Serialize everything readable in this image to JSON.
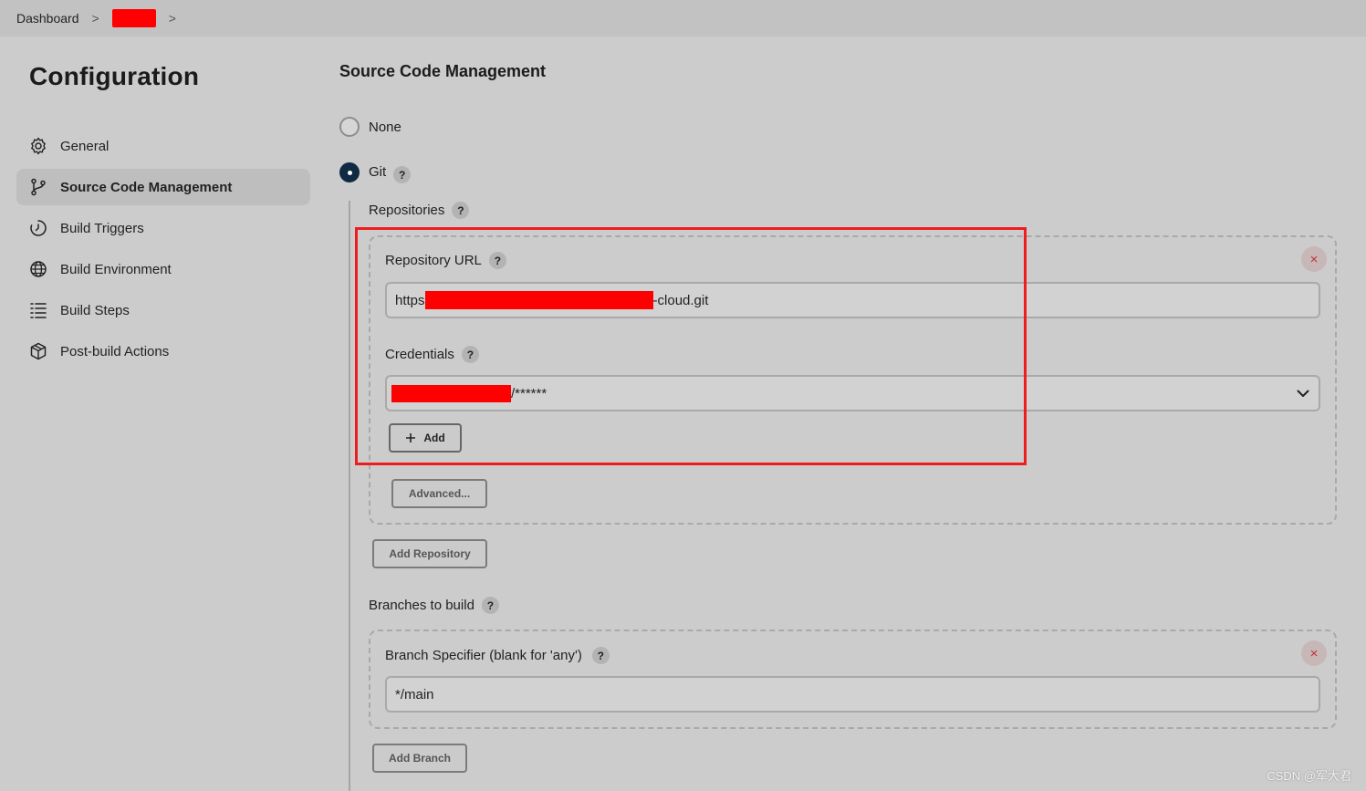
{
  "breadcrumb": {
    "home": "Dashboard",
    "separator": ">"
  },
  "sidebar": {
    "title": "Configuration",
    "items": [
      {
        "label": "General",
        "icon": "gear-icon"
      },
      {
        "label": "Source Code Management",
        "icon": "git-branch-icon",
        "active": true
      },
      {
        "label": "Build Triggers",
        "icon": "clock-icon"
      },
      {
        "label": "Build Environment",
        "icon": "globe-icon"
      },
      {
        "label": "Build Steps",
        "icon": "list-icon"
      },
      {
        "label": "Post-build Actions",
        "icon": "package-icon"
      }
    ]
  },
  "scm": {
    "title": "Source Code Management",
    "options": [
      {
        "label": "None",
        "checked": false
      },
      {
        "label": "Git",
        "checked": true
      }
    ],
    "repositories_label": "Repositories",
    "repository_url_label": "Repository URL",
    "repository_url_prefix": "https",
    "repository_url_suffix": "-cloud.git",
    "credentials_label": "Credentials",
    "credentials_value_suffix": "/******",
    "add_label": "Add",
    "advanced_label": "Advanced...",
    "add_repository_label": "Add Repository",
    "branches_label": "Branches to build",
    "branch_specifier_label": "Branch Specifier (blank for 'any')",
    "branch_specifier_value": "*/main",
    "add_branch_label": "Add Branch",
    "help_glyph": "?",
    "close_glyph": "×"
  },
  "watermark": "CSDN @军大君",
  "colors": {
    "background": "#cccccc",
    "highlight": "#ee1c1c",
    "redaction": "#ff0000",
    "radio_checked": "#102a43"
  }
}
